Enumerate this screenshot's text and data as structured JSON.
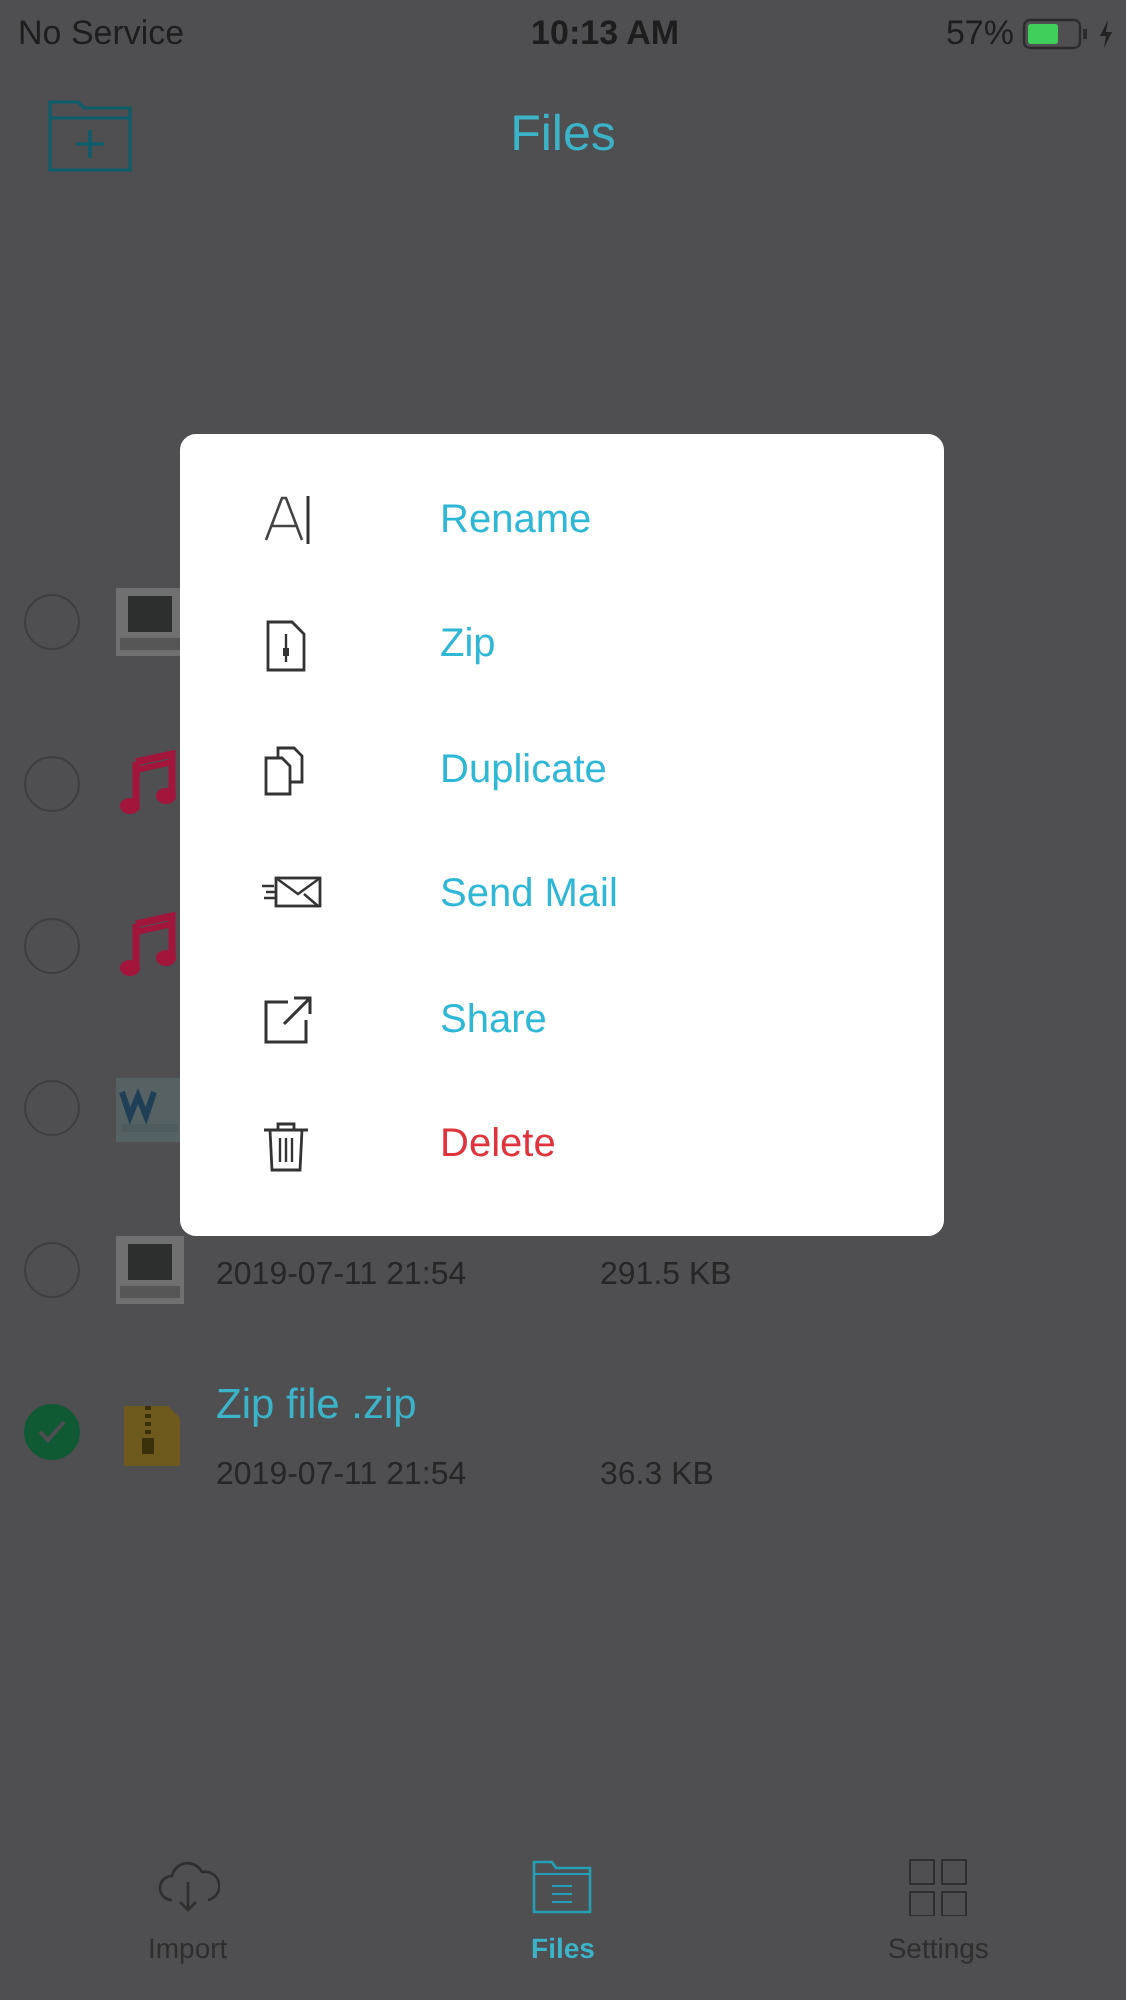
{
  "status_bar": {
    "carrier": "No Service",
    "time": "10:13 AM",
    "battery": "57%"
  },
  "nav": {
    "title": "Files"
  },
  "files": [
    {
      "kind": "image",
      "selected": false
    },
    {
      "kind": "music",
      "selected": false
    },
    {
      "kind": "music",
      "selected": false
    },
    {
      "kind": "document",
      "selected": false
    },
    {
      "kind": "image",
      "selected": false,
      "date": "2019-07-11 21:54",
      "size": "291.5 KB"
    },
    {
      "kind": "zip",
      "selected": true,
      "name": "Zip file .zip",
      "date": "2019-07-11 21:54",
      "size": "36.3 KB"
    }
  ],
  "menu": [
    {
      "kind": "rename",
      "label": "Rename",
      "destructive": false
    },
    {
      "kind": "zip",
      "label": "Zip",
      "destructive": false
    },
    {
      "kind": "duplicate",
      "label": "Duplicate",
      "destructive": false
    },
    {
      "kind": "mail",
      "label": "Send Mail",
      "destructive": false
    },
    {
      "kind": "share",
      "label": "Share",
      "destructive": false
    },
    {
      "kind": "delete",
      "label": "Delete",
      "destructive": true
    }
  ],
  "tabs": [
    {
      "kind": "import",
      "label": "Import",
      "selected": false
    },
    {
      "kind": "files",
      "label": "Files",
      "selected": true
    },
    {
      "kind": "settings",
      "label": "Settings",
      "selected": false
    }
  ]
}
